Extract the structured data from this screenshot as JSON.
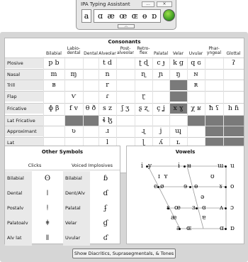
{
  "mini": {
    "title": "IPA Typing Assistant",
    "dots_label": "...",
    "close_label": "×",
    "selected_char": "a",
    "row_chars": "ɑ æ œ ɶ ɵ ɒ",
    "chevron": "︿",
    "go_icon": "green-orb-icon"
  },
  "consonants": {
    "title": "Consonants",
    "columns": [
      "Bilabial",
      "Labio-\ndental",
      "Dental",
      "Alveolar",
      "Post-\nalveolar",
      "Retro-\nflex",
      "Palatal",
      "Velar",
      "Uvular",
      "Phar-\nyngeal",
      "Glottal"
    ],
    "rows": [
      {
        "label": "Plosive",
        "cells": [
          "p b",
          "",
          "",
          "t d",
          "",
          "ʈ ɖ",
          "c ɟ",
          "k ɡ",
          "q ɢ",
          "",
          "ʔ"
        ]
      },
      {
        "label": "Nasal",
        "cells": [
          "m",
          "ɱ",
          "",
          "n",
          "",
          "ɳ",
          "ɲ",
          "ŋ",
          "ɴ",
          "",
          ""
        ]
      },
      {
        "label": "Trill",
        "cells": [
          "ʙ",
          "",
          "",
          "r",
          "",
          "",
          "",
          "",
          "ʀ",
          "",
          ""
        ]
      },
      {
        "label": "Flap",
        "cells": [
          "",
          "ⱱ",
          "",
          "ɾ",
          "",
          "ɽ",
          "",
          "",
          "",
          "",
          ""
        ]
      },
      {
        "label": "Fricative",
        "cells": [
          "ɸ β",
          "f v",
          "θ ð",
          "s z",
          "ʃ ʒ",
          "ʂ ʐ",
          "ç ʝ",
          "x ɣ",
          "χ ʁ",
          "ħ ʕ",
          "h ɦ"
        ]
      },
      {
        "label": "Lat Fricative",
        "cells": [
          "",
          "",
          "",
          "ɬ ɮ",
          "",
          "",
          "",
          "",
          "",
          "",
          ""
        ]
      },
      {
        "label": "Approximant",
        "cells": [
          "",
          "ʋ",
          "",
          "ɹ",
          "",
          "ɻ",
          "j",
          "ɰ",
          "",
          "",
          ""
        ]
      },
      {
        "label": "Lat Approximant",
        "cells": [
          "",
          "",
          "",
          "l",
          "",
          "ɭ",
          "ʎ",
          "ʟ",
          "",
          "",
          ""
        ]
      }
    ]
  },
  "other": {
    "title": "Other Symbols",
    "clicks_head": "Clicks",
    "implosives_head": "Voiced Implosives",
    "clicks": [
      {
        "label": "Bilabial",
        "sym": "ʘ"
      },
      {
        "label": "Dental",
        "sym": "ǀ"
      },
      {
        "label": "Postalv",
        "sym": "ǃ"
      },
      {
        "label": "Palatoalv",
        "sym": "ǂ"
      },
      {
        "label": "Alv lat",
        "sym": "ǁ"
      }
    ],
    "implosives": [
      {
        "label": "Bilabial",
        "sym": "ɓ"
      },
      {
        "label": "Dent/Alv",
        "sym": "ɗ"
      },
      {
        "label": "Palatal",
        "sym": "ʄ"
      },
      {
        "label": "Velar",
        "sym": "ɠ"
      },
      {
        "label": "Uvular",
        "sym": "ʛ"
      }
    ]
  },
  "vowels": {
    "title": "Vowels",
    "symbols": {
      "i": "i",
      "y": "y",
      "ɨ": "ɨ",
      "ʉ": "ʉ",
      "ɯ": "ɯ",
      "u": "u",
      "ɪ": "ɪ",
      "ʏ": "ʏ",
      "ʊ": "ʊ",
      "e": "e",
      "ø": "ø",
      "ɘ": "ɘ",
      "ɵ": "ɵ",
      "ɤ": "ɤ",
      "o": "o",
      "ə": "ə",
      "ɛ": "ɛ",
      "œ": "œ",
      "ɜ": "ɜ",
      "ɞ": "ɞ",
      "ʌ": "ʌ",
      "ɔ": "ɔ",
      "æ": "æ",
      "ɐ": "ɐ",
      "a": "a",
      "ɶ": "ɶ",
      "ɑ": "ɑ",
      "ɒ": "ɒ"
    }
  },
  "footer": {
    "button": "Show Diacritics, Suprasegmentals, & Tones"
  }
}
